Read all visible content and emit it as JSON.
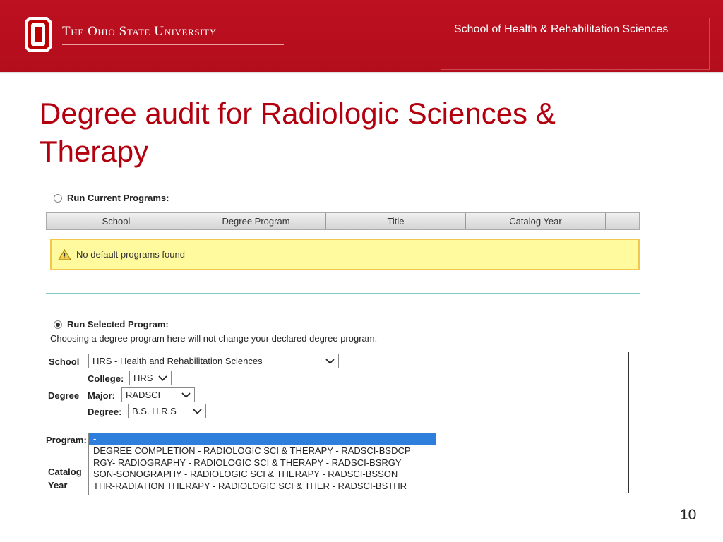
{
  "header": {
    "university_name": "The Ohio State University",
    "department": "School of Health & Rehabilitation Sciences",
    "brand_color": "#bb0000"
  },
  "slide": {
    "title": "Degree audit for Radiologic Sciences & Therapy",
    "page_number": "10"
  },
  "audit_form": {
    "current_programs": {
      "label": "Run Current Programs:",
      "selected": false,
      "columns": [
        "School",
        "Degree Program",
        "Title",
        "Catalog Year",
        ""
      ],
      "warning_icon": "warning-triangle-icon",
      "warning_text": "No default programs found"
    },
    "selected_program": {
      "label": "Run Selected Program:",
      "selected": true,
      "note": "Choosing a degree program here will not change your declared degree program.",
      "school_label": "School",
      "school_value": "HRS - Health and Rehabilitation Sciences",
      "degree_label": "Degree",
      "college_label": "College:",
      "college_value": "HRS",
      "major_label": "Major:",
      "major_value": "RADSCI",
      "degree_sub_label": "Degree:",
      "degree_value": "B.S. H.R.S",
      "program_label": "Program:",
      "catalog_label_line1": "Catalog",
      "catalog_label_line2": "Year",
      "program_options": [
        "-",
        "DEGREE COMPLETION - RADIOLOGIC SCI & THERAPY - RADSCI-BSDCP",
        "RGY- RADIOGRAPHY - RADIOLOGIC SCI & THERAPY - RADSCI-BSRGY",
        "SON-SONOGRAPHY - RADIOLOGIC SCI & THERAPY - RADSCI-BSSON",
        "THR-RADIATION THERAPY - RADIOLOGIC SCI & THER - RADSCI-BSTHR"
      ]
    }
  }
}
